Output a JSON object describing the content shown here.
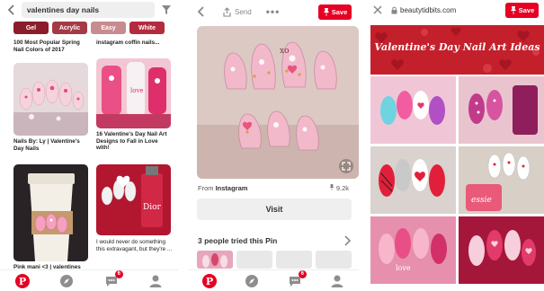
{
  "search_panel": {
    "query": "valentines day nails",
    "chips": [
      "Gel",
      "Acrylic",
      "Easy",
      "White"
    ],
    "captions": {
      "top_left": "100 Most Popular Spring Nail Colors of 2017",
      "top_right": "instagram coffin nails...",
      "mid_left": "Nails By: Ly | Valentine's Day Nails",
      "mid_right": "16 Valentine's Day Nail Art Designs to Fall in Love with!",
      "bottom_right": "I would never do something this extravagant, but they're ...",
      "bottom_left": "Pink mani <3 | valentines"
    },
    "tabs": {
      "messages_badge": "6"
    }
  },
  "pin_panel": {
    "send_label": "Send",
    "save_label": "Save",
    "from_prefix": "From",
    "from_source": "Instagram",
    "save_count": "9.2k",
    "visit_label": "Visit",
    "tried_label": "3 people tried this Pin",
    "tabs": {
      "messages_badge": "6"
    }
  },
  "browser_panel": {
    "url": "beautytidbits.com",
    "save_label": "Save",
    "banner_title": "Valentine's Day Nail Art Ideas"
  },
  "colors": {
    "pinterest_red": "#e60023",
    "chip_dark": "#8a1c2b",
    "banner_red": "#c4202c"
  }
}
